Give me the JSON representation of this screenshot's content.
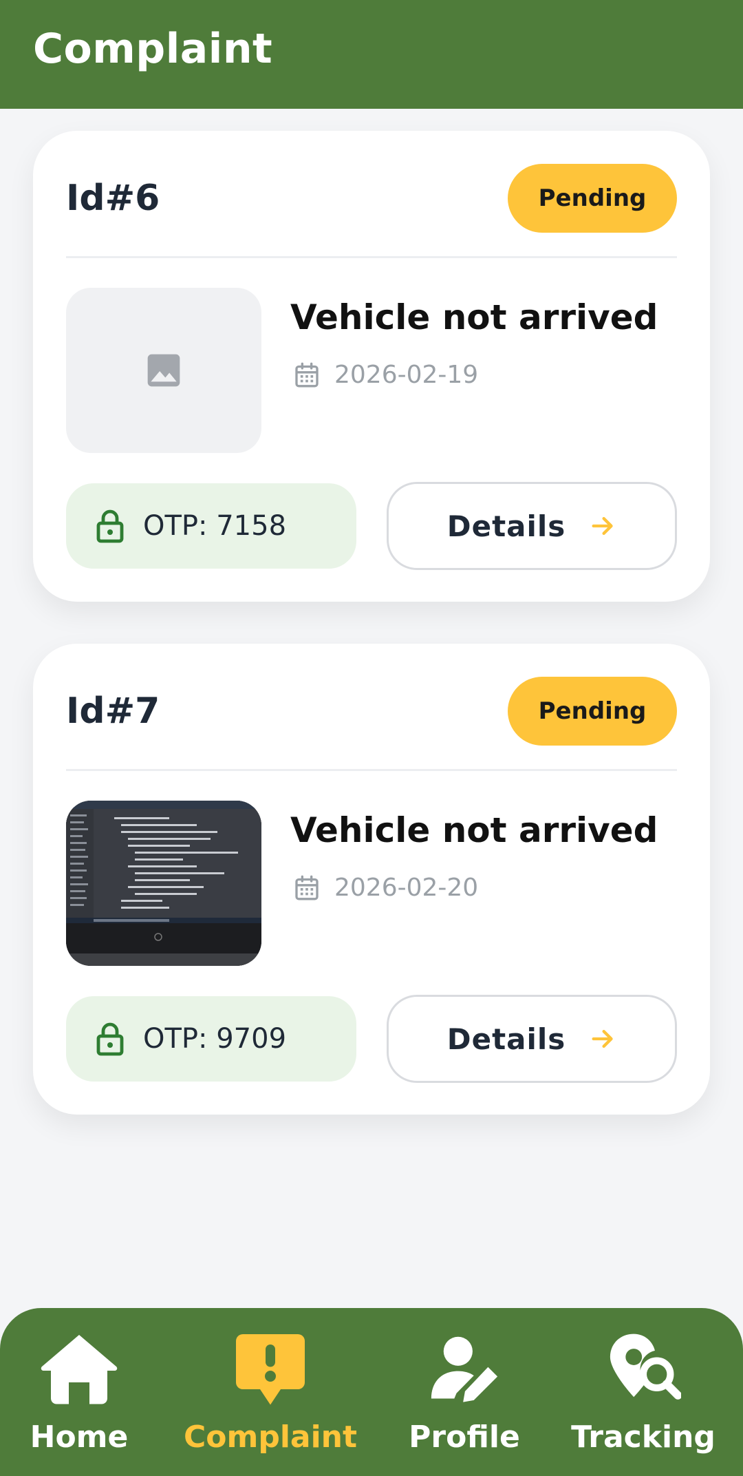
{
  "app_bar": {
    "title": "Complaint"
  },
  "complaints": [
    {
      "id_label": "Id#6",
      "status": "Pending",
      "title": "Vehicle not arrived",
      "date": "2026-02-19",
      "image": "image-placeholder-icon",
      "otp": "OTP: 7158",
      "details_label": "Details"
    },
    {
      "id_label": "Id#7",
      "status": "Pending",
      "title": "Vehicle not arrived",
      "date": "2026-02-20",
      "image": "laptop-screen-photo",
      "otp": "OTP: 9709",
      "details_label": "Details"
    }
  ],
  "bottom_nav": {
    "items": [
      {
        "label": "Home",
        "icon": "home-icon",
        "active": false
      },
      {
        "label": "Complaint",
        "icon": "complaint-alert-icon",
        "active": true
      },
      {
        "label": "Profile",
        "icon": "profile-edit-icon",
        "active": false
      },
      {
        "label": "Tracking",
        "icon": "location-search-icon",
        "active": false
      }
    ]
  },
  "colors": {
    "primary_green": "#4f7c3a",
    "accent_yellow": "#fec43a",
    "otp_background": "#e9f4e7",
    "page_background": "#f4f5f7"
  }
}
